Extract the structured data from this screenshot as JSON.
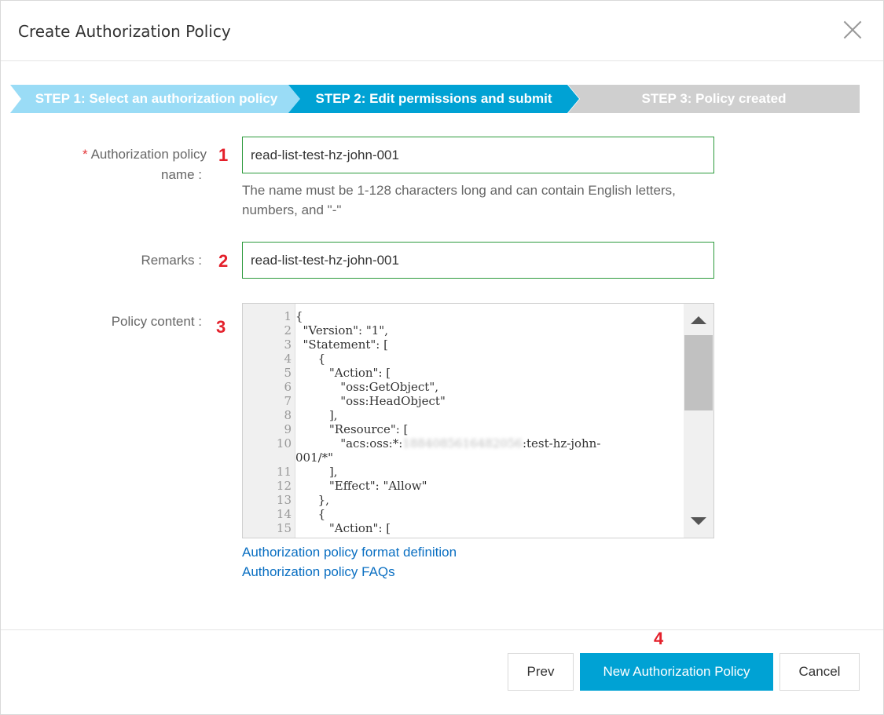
{
  "dialog": {
    "title": "Create Authorization Policy"
  },
  "steps": [
    {
      "label": "STEP 1: Select an authorization policy"
    },
    {
      "label": "STEP 2: Edit permissions and submit"
    },
    {
      "label": "STEP 3: Policy created"
    }
  ],
  "form": {
    "name_required_mark": "*",
    "name_label_line1": "Authorization policy",
    "name_label_line2": "name :",
    "name_value": "read-list-test-hz-john-001",
    "name_hint_line1": "The name must be 1-128 characters long and can contain English letters,",
    "name_hint_line2": "numbers, and \"-\"",
    "remarks_label": "Remarks :",
    "remarks_value": "read-list-test-hz-john-001",
    "policy_label": "Policy content :"
  },
  "markers": [
    "1",
    "2",
    "3",
    "4"
  ],
  "editor": {
    "lines": [
      {
        "n": "1",
        "t": "{"
      },
      {
        "n": "2",
        "t": "  \"Version\": \"1\","
      },
      {
        "n": "3",
        "t": "  \"Statement\": ["
      },
      {
        "n": "4",
        "t": "      {"
      },
      {
        "n": "5",
        "t": "         \"Action\": ["
      },
      {
        "n": "6",
        "t": "            \"oss:GetObject\","
      },
      {
        "n": "7",
        "t": "            \"oss:HeadObject\""
      },
      {
        "n": "8",
        "t": "         ],"
      },
      {
        "n": "9",
        "t": "         \"Resource\": ["
      },
      {
        "n": "10",
        "t": "            \"acs:oss:*:",
        "blur": "1884085616482056",
        "t2": ":test-hz-john-"
      },
      {
        "n": "",
        "t": "001/*\""
      },
      {
        "n": "11",
        "t": "         ],"
      },
      {
        "n": "12",
        "t": "         \"Effect\": \"Allow\""
      },
      {
        "n": "13",
        "t": "      },"
      },
      {
        "n": "14",
        "t": "      {"
      },
      {
        "n": "15",
        "t": "         \"Action\": ["
      }
    ]
  },
  "links": {
    "format_definition": "Authorization policy format definition",
    "faqs": "Authorization policy FAQs"
  },
  "footer": {
    "prev_label": "Prev",
    "submit_label": "New Authorization Policy",
    "cancel_label": "Cancel"
  }
}
